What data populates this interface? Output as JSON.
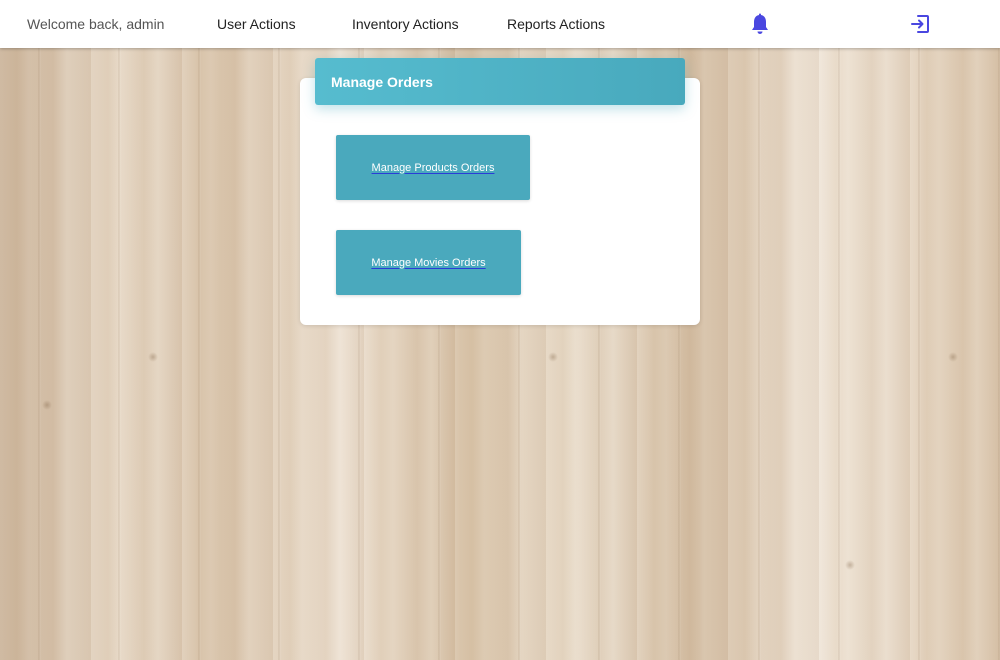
{
  "navbar": {
    "welcome": "Welcome back, admin",
    "links": [
      "User Actions",
      "Inventory Actions",
      "Reports Actions"
    ],
    "icons": {
      "notifications": "bell-icon",
      "logout": "logout-icon"
    },
    "icon_color": "#4a47e0"
  },
  "card": {
    "title": "Manage Orders",
    "buttons": [
      "Manage Products Orders",
      "Manage Movies Orders"
    ],
    "accent_color": "#4aa9bd"
  }
}
